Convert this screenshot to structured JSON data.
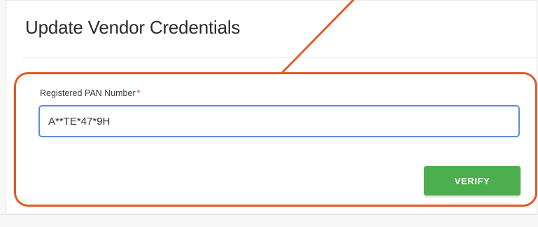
{
  "page": {
    "title": "Update Vendor Credentials"
  },
  "form": {
    "pan_field": {
      "label": "Registered PAN Number",
      "required_marker": "*",
      "value": "A**TE*47*9H"
    },
    "verify_label": "VERIFY"
  },
  "colors": {
    "highlight": "#e35a25",
    "input_border": "#5b8fd6",
    "verify_button": "#4cae4f"
  },
  "icons": {
    "annotation": "arrow-pointer"
  }
}
